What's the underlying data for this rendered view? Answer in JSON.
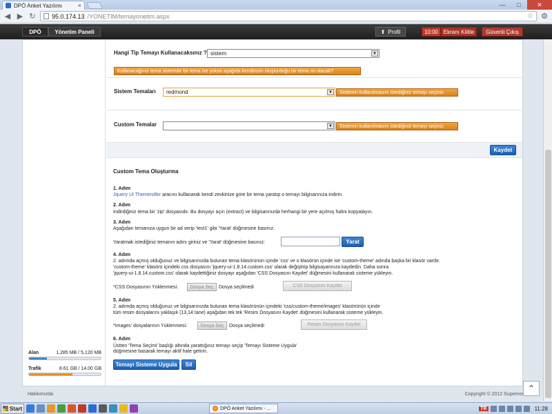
{
  "browser": {
    "tab_title": "DPÖ Anket Yazılımı",
    "tab_close": "×",
    "url_host": "95.0.174.13",
    "url_path": "/YONETIM/temayonetim.aspx",
    "window_min": "—",
    "window_max": "□",
    "window_close": "✕"
  },
  "header": {
    "crumb_root": "DPÖ",
    "crumb_panel": "Yönetim Paneli",
    "profile_label": "Profil",
    "timer": "10:00",
    "lock_label": "Ekranı Kilitle",
    "logout_label": "Güvenli Çıkış"
  },
  "sidebar": {
    "disk_label": "Alan",
    "disk_value": "1,285 MB / 5,120 MB",
    "disk_fraction": 0.25,
    "traffic_label": "Trafik",
    "traffic_value": "8.61 GB / 14.00 GB",
    "traffic_fraction": 0.61
  },
  "theme_type": {
    "label": "Hangi Tip Temayı Kullanacaksınız ?",
    "selected": "sistem",
    "hint": "Kullanacağınız tema sistemde bir tema ise yoksa aşağıda kendinizin oluşturduğu bir tema mı olacak?"
  },
  "system_themes": {
    "label": "Sistem Temaları",
    "selected": "redmond",
    "hint": "Sistemin kullanılmasını istediğiniz temayı seçiniz."
  },
  "custom_themes": {
    "label": "Custom Temalar",
    "selected": "",
    "hint": "Sistemin kullanılmasını istediğiniz temayı seçiniz."
  },
  "save_label": "Kaydet",
  "custom": {
    "title": "Custom Tema Oluşturma",
    "step1_title": "1. Adım",
    "step1_link": "Jquery UI Themeroller",
    "step1_text": " aracını kullanarak kendi zevkinize göre bir tema yaratıp o temayı bilgisarınıza indirin.",
    "step2_title": "2. Adım",
    "step2_text": "İndirdiğiniz tema bir 'zip' dosyasıdır. Bu dosyayı açın (extract) ve bilgisarınızda herhangi bir yere açılmış halini kopyalayın.",
    "step3_title": "3. Adım",
    "step3_text": "Aşağıdan temanıza uygun bir ad verip 'test1' gibi 'Yarat' düğmesine basınız.",
    "step3_prompt": "Yaratmak istediğiniz temanın adını giriniz ve 'Yarat' düğmesine basınız:",
    "step3_button": "Yarat",
    "step4_title": "4. Adım",
    "step4_line1": "2. adımda açmış olduğunuz ve bilgisarınızda bulunan tema klasörünün içinde 'css' ve o klasörün içinde ise 'custom-theme' adında başka bir klasör vardır.",
    "step4_line2": "'custom-theme' klasörü içindeki css dosyasını  'jquery-ui-1.8.14.custom.css' olarak değiştirip bilgisayarınıza kaydedin. Daha sonra",
    "step4_line3": "'jquery-ui-1.8.14.custom.css' olarak kaydettiğiniz dosyayı aşağıdan 'CSS Dosyasını Kaydet' düğmesini kullanarak sisteme yükleyin.",
    "css_upload_label": "*CSS Dosyasının Yüklenmesi:",
    "file_choose": "Dosya Seç",
    "no_file": "Dosya seçilmedi",
    "css_save": "CSS Dosyasını Kaydet",
    "step5_title": "5. Adım",
    "step5_line1": "2. adımda açmış olduğunuz ve bilgisarınızda bulunan tema klasörünün içindeki 'css/custom-theme/images' klasörünün içinde",
    "step5_line2": "tüm resim dosyalarını yaklaşık (13,14 tane) aşağıdan tek tek 'Resim Dosyasını Kaydet' düğmesini kullanarak sisteme yükleyin.",
    "images_upload_label": "*Images' dosyalarının Yüklenmesi:",
    "image_save": "Resim Dosyasını Kaydet",
    "step6_title": "6. Adım",
    "step6_line1": "Üstten 'Tema Seçimi' başlığı altında yarattığınız temayı seçip 'Temayı Sisteme Uygula'",
    "step6_line2": "düğmesine basarak temayı aktif hale getirin.",
    "apply_button": "Temayı Sisteme Uygula",
    "delete_button": "Sil"
  },
  "footer": {
    "about": "Hakkımızda",
    "copyright": "Copyright © 2012 Supernova"
  },
  "taskbar": {
    "start": "Start",
    "window_item": "DPÖ Anket Yazılımı - ...",
    "lang": "TR",
    "clock": "11:28"
  },
  "colors": {
    "accent_blue": "#1d5fae",
    "hint_orange": "#e08a25",
    "header_dark": "#2a2a2a",
    "logout_red": "#b03a2e"
  }
}
